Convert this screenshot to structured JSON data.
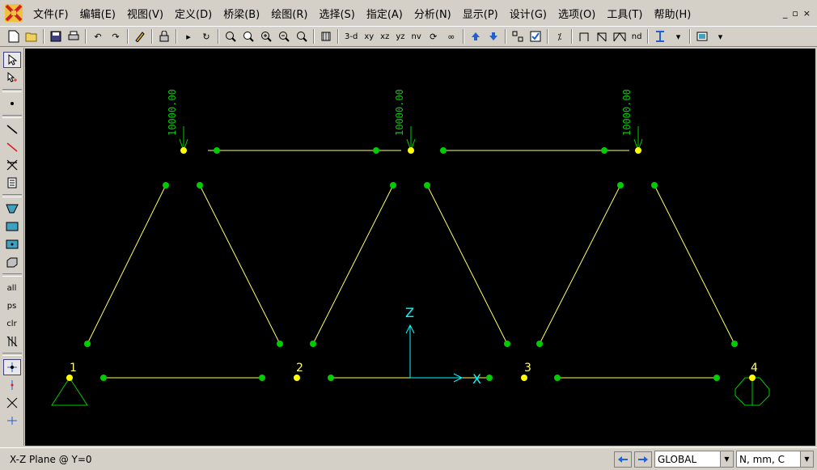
{
  "menu": {
    "items": [
      {
        "label": "文件(F)"
      },
      {
        "label": "编辑(E)"
      },
      {
        "label": "视图(V)"
      },
      {
        "label": "定义(D)"
      },
      {
        "label": "桥梁(B)"
      },
      {
        "label": "绘图(R)"
      },
      {
        "label": "选择(S)"
      },
      {
        "label": "指定(A)"
      },
      {
        "label": "分析(N)"
      },
      {
        "label": "显示(P)"
      },
      {
        "label": "设计(G)"
      },
      {
        "label": "选项(O)"
      },
      {
        "label": "工具(T)"
      },
      {
        "label": "帮助(H)"
      }
    ],
    "win_min": "_",
    "win_restore": "▫",
    "win_close": "×"
  },
  "toolbar": {
    "view_3d": "3-d",
    "view_xy": "xy",
    "view_xz": "xz",
    "view_yz": "yz",
    "view_nv": "nv",
    "nd": "nd"
  },
  "lefttools": {
    "all": "all",
    "ps": "ps",
    "clr": "clr"
  },
  "canvas": {
    "joint_labels": [
      "1",
      "2",
      "3",
      "4"
    ],
    "load_values": [
      "10000.00",
      "10000.00",
      "10000.00"
    ],
    "axis_z": "Z",
    "axis_x": "X",
    "colors": {
      "background": "#000000",
      "frame": "#ffff66",
      "joint_end": "#00cc00",
      "joint": "#ffff00",
      "load": "#00cc00",
      "axis": "#00ffff",
      "support": "#00cc00",
      "label": "#ffff66"
    }
  },
  "status": {
    "text": "X-Z Plane @ Y=0",
    "coord_system": "GLOBAL",
    "units": "N, mm, C"
  }
}
